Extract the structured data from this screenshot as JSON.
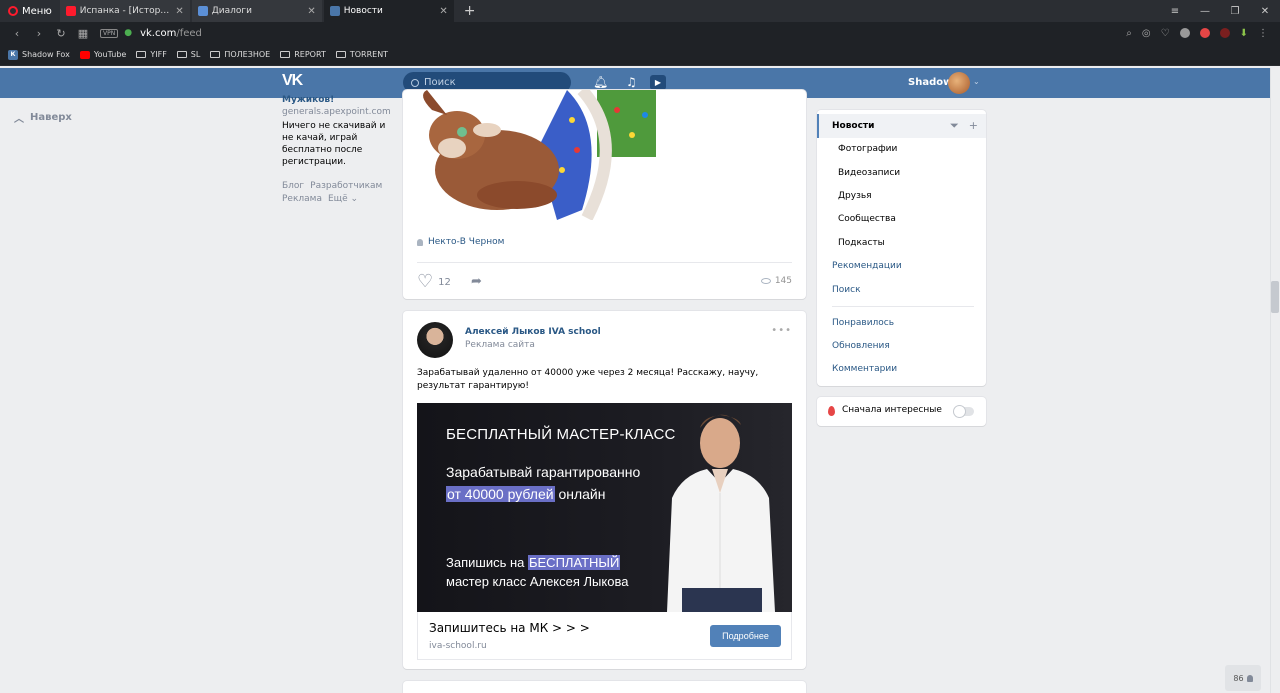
{
  "browser": {
    "menu_label": "Меню",
    "tabs": [
      {
        "title": "Испанка - [История Меди",
        "color": "#ff1b2d"
      },
      {
        "title": "Диалоги",
        "color": "#5b8fd6"
      },
      {
        "title": "Новости",
        "color": "#4a76a8"
      }
    ],
    "url_host": "vk.com",
    "url_path": "/feed",
    "vpn_label": "VPN",
    "bookmarks": [
      "Shadow Fox",
      "YouTube",
      "YIFF",
      "SL",
      "ПОЛЕЗНОЕ",
      "REPORT",
      "TORRENT"
    ]
  },
  "header": {
    "logo": "VK",
    "search_placeholder": "Поиск",
    "user_name": "Shadow"
  },
  "left": {
    "back_up": "Наверх",
    "ad": {
      "title": "Мужиков!",
      "domain": "generals.apexpoint.com",
      "text": "Ничего не скачивай и не качай, играй бесплатно после регистрации."
    },
    "footer": {
      "blog": "Блог",
      "developers": "Разработчикам",
      "ads": "Реклама",
      "more": "Ещё ⌄"
    }
  },
  "post1": {
    "author": "Некто-В Черном",
    "likes": "12",
    "views": "145"
  },
  "post2": {
    "author": "Алексей Лыков IVA school",
    "subtitle": "Реклама сайта",
    "text": "Зарабатывай удаленно от 40000 уже через 2 месяца! Расскажу, научу, результат гарантирую!",
    "banner": {
      "title": "БЕСПЛАТНЫЙ МАСТЕР-КЛАСС",
      "line1": "Зарабатывай гарантированно",
      "line2_hl": "от 40000 рублей",
      "line2_rest": " онлайн",
      "line3_pre": "Запишись на ",
      "line3_hl": "БЕСПЛАТНЫЙ",
      "line4": "мастер класс Алексея Лыкова"
    },
    "cta_title": "Запишитесь на МК > > >",
    "cta_url": "iva-school.ru",
    "cta_button": "Подробнее"
  },
  "right_menu": {
    "items": [
      "Новости",
      "Фотографии",
      "Видеозаписи",
      "Друзья",
      "Сообщества",
      "Подкасты",
      "Рекомендации",
      "Поиск",
      "Понравилось",
      "Обновления",
      "Комментарии"
    ],
    "interesting_label": "Сначала интересные"
  },
  "online_count": "86"
}
